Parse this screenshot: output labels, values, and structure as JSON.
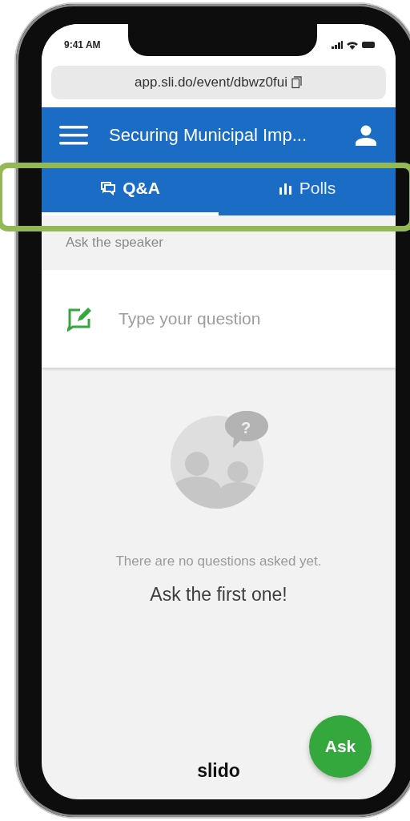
{
  "status_bar": {
    "time": "9:41 AM"
  },
  "address_bar": {
    "url": "app.sli.do/event/dbwz0fui"
  },
  "header": {
    "title": "Securing Municipal Imp..."
  },
  "tabs": [
    {
      "label": "Q&A",
      "kind": "qa",
      "selected": true
    },
    {
      "label": "Polls",
      "kind": "polls",
      "selected": false
    }
  ],
  "section_label": "Ask the speaker",
  "question_field": {
    "placeholder": "Type your question"
  },
  "empty_state": {
    "bubble_mark": "?",
    "message": "There are no questions asked yet.",
    "prompt": "Ask the first one!"
  },
  "ask_button": {
    "label": "Ask"
  },
  "logo": {
    "text": "slido"
  }
}
